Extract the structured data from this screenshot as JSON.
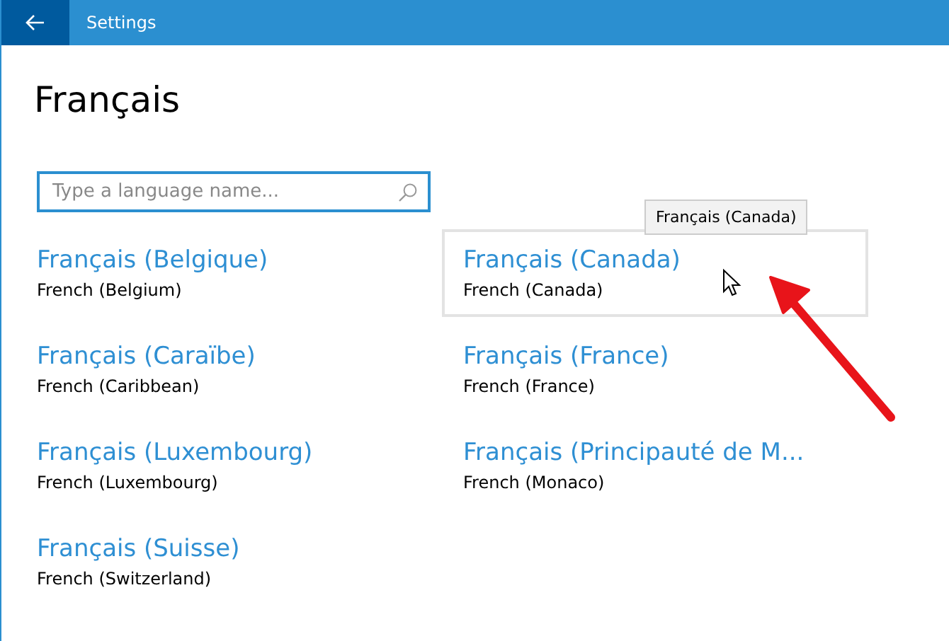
{
  "window": {
    "title": "Settings"
  },
  "page_title": "Français",
  "search": {
    "placeholder": "Type a language name..."
  },
  "languages": [
    {
      "name": "Français (Belgique)",
      "english": "French (Belgium)",
      "hovered": false
    },
    {
      "name": "Français (Canada)",
      "english": "French (Canada)",
      "hovered": true
    },
    {
      "name": "Français (Caraïbe)",
      "english": "French (Caribbean)",
      "hovered": false
    },
    {
      "name": "Français (France)",
      "english": "French (France)",
      "hovered": false
    },
    {
      "name": "Français (Luxembourg)",
      "english": "French (Luxembourg)",
      "hovered": false
    },
    {
      "name": "Français (Principauté de M...",
      "english": "French (Monaco)",
      "hovered": false
    },
    {
      "name": "Français (Suisse)",
      "english": "French (Switzerland)",
      "hovered": false
    }
  ],
  "tooltip": "Français (Canada)"
}
